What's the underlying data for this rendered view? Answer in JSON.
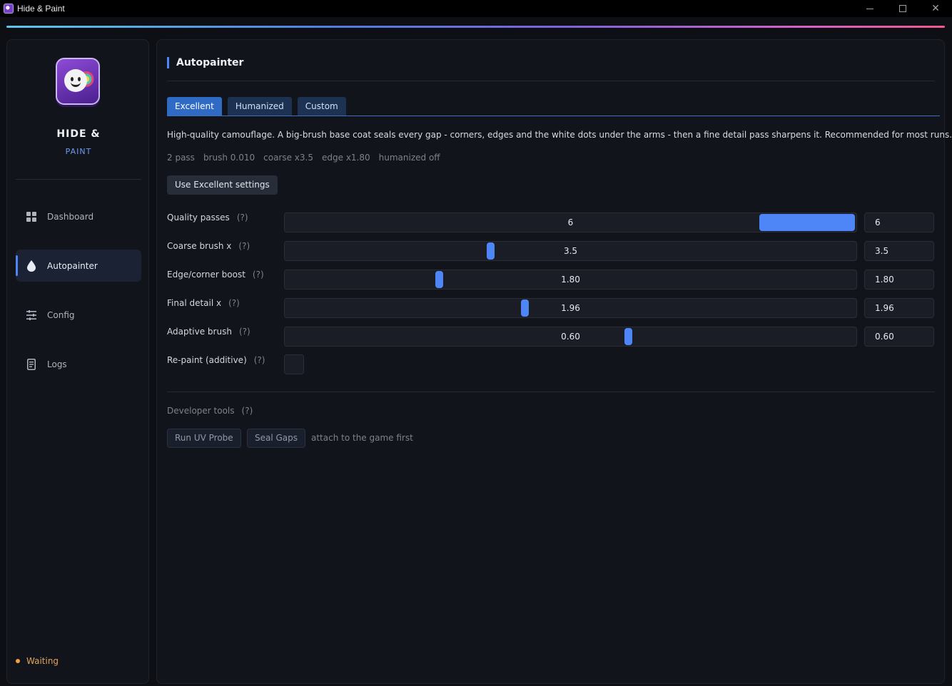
{
  "window": {
    "title": "Hide & Paint"
  },
  "sidebar": {
    "brand_line1": "HIDE &",
    "brand_line2": "PAINT",
    "items": [
      {
        "label": "Dashboard",
        "icon": "grid-icon"
      },
      {
        "label": "Autopainter",
        "icon": "droplet-icon"
      },
      {
        "label": "Config",
        "icon": "sliders-icon"
      },
      {
        "label": "Logs",
        "icon": "document-icon"
      }
    ],
    "status": "Waiting"
  },
  "main": {
    "title": "Autopainter",
    "tabs": [
      {
        "label": "Excellent",
        "active": true
      },
      {
        "label": "Humanized",
        "active": false
      },
      {
        "label": "Custom",
        "active": false
      }
    ],
    "description": "High-quality camouflage. A big-brush base coat seals every gap - corners, edges and the white dots under the arms - then a fine detail pass sharpens it. Recommended for most runs.",
    "meta": [
      "2 pass",
      "brush 0.010",
      "coarse x3.5",
      "edge x1.80",
      "humanized off"
    ],
    "use_button": "Use Excellent settings",
    "help_mark": "(?)",
    "settings": [
      {
        "label": "Quality passes",
        "value": "6",
        "fill": 0.83
      },
      {
        "label": "Coarse brush x",
        "value": "3.5",
        "fill": 0.36
      },
      {
        "label": "Edge/corner boost",
        "value": "1.80",
        "fill": 0.27
      },
      {
        "label": "Final detail x",
        "value": "1.96",
        "fill": 0.42
      },
      {
        "label": "Adaptive brush",
        "value": "0.60",
        "fill": 0.6
      }
    ],
    "repaint_label": "Re-paint (additive)",
    "repaint_checked": false,
    "developer": {
      "label": "Developer tools",
      "buttons": [
        "Run UV Probe",
        "Seal Gaps"
      ],
      "note": "attach to the game first"
    }
  },
  "colors": {
    "accent": "#4f86f7",
    "status": "#f0a040"
  }
}
